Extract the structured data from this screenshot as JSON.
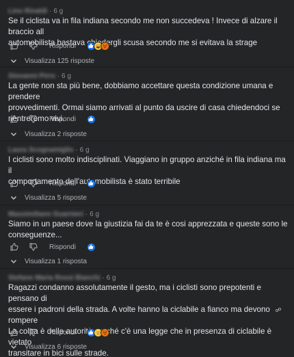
{
  "ui": {
    "reply_label": "Rispondi"
  },
  "comments": [
    {
      "time": "· 6 g",
      "author": "Lino Rinaldi",
      "lines": [
        "Se il ciclista va in fila indiana secondo me non succedeva ! Invece di alzare il braccio all",
        "automobilista bastava chiedergli scusa secondo me si evitava la strage"
      ],
      "reactions": [
        "like",
        "haha",
        "angry"
      ],
      "replies_label": "Visualizza 125 risposte"
    },
    {
      "time": "· 6 g",
      "author": "Giovanni Pirro",
      "lines": [
        "La gente non sta più bene, dobbiamo accettare questa condizione umana e prendere",
        "provvedimenti. Ormai siamo arrivati al punto da uscire di casa chiedendoci se",
        "rientreremo vivi."
      ],
      "reactions": [
        "like"
      ],
      "replies_label": "Visualizza 2 risposte"
    },
    {
      "time": "· 6 g",
      "author": "Laura Scognamiglio",
      "lines": [
        "I ciclisti sono molto indisciplinati. Viaggiano in gruppo anziché in fila indiana ma il",
        "comportamento dell'automobilista è stato terribile"
      ],
      "reactions": [
        "like"
      ],
      "replies_label": "Visualizza 5 risposte"
    },
    {
      "time": "· 6 g",
      "author": "Massimiliano Guarnieri",
      "lines": [
        "Siamo in un paese dove la giustizia fai da te è cosi apprezzata e queste sono le",
        "conseguenze..."
      ],
      "reactions": [
        "like"
      ],
      "replies_label": "Visualizza 1 risposta"
    },
    {
      "time": "· 6 g",
      "author": "Stefano Maria Rossi Bianchi",
      "lines": [
        "Ragazzi condanno assolutamente il gesto, ma i ciclisti sono prepotenti e pensano di",
        "essere i padroni della strada. A volte hanno la ciclabile a fianco ma devono rompere",
        "La colpa è delle autorità perché c'è una legge che in presenza di ciclabile è vietato",
        "transitare in bici sulle strade."
      ],
      "reactions": [
        "like",
        "sad",
        "angry"
      ],
      "replies_label": "Visualizza 6 risposte"
    }
  ]
}
